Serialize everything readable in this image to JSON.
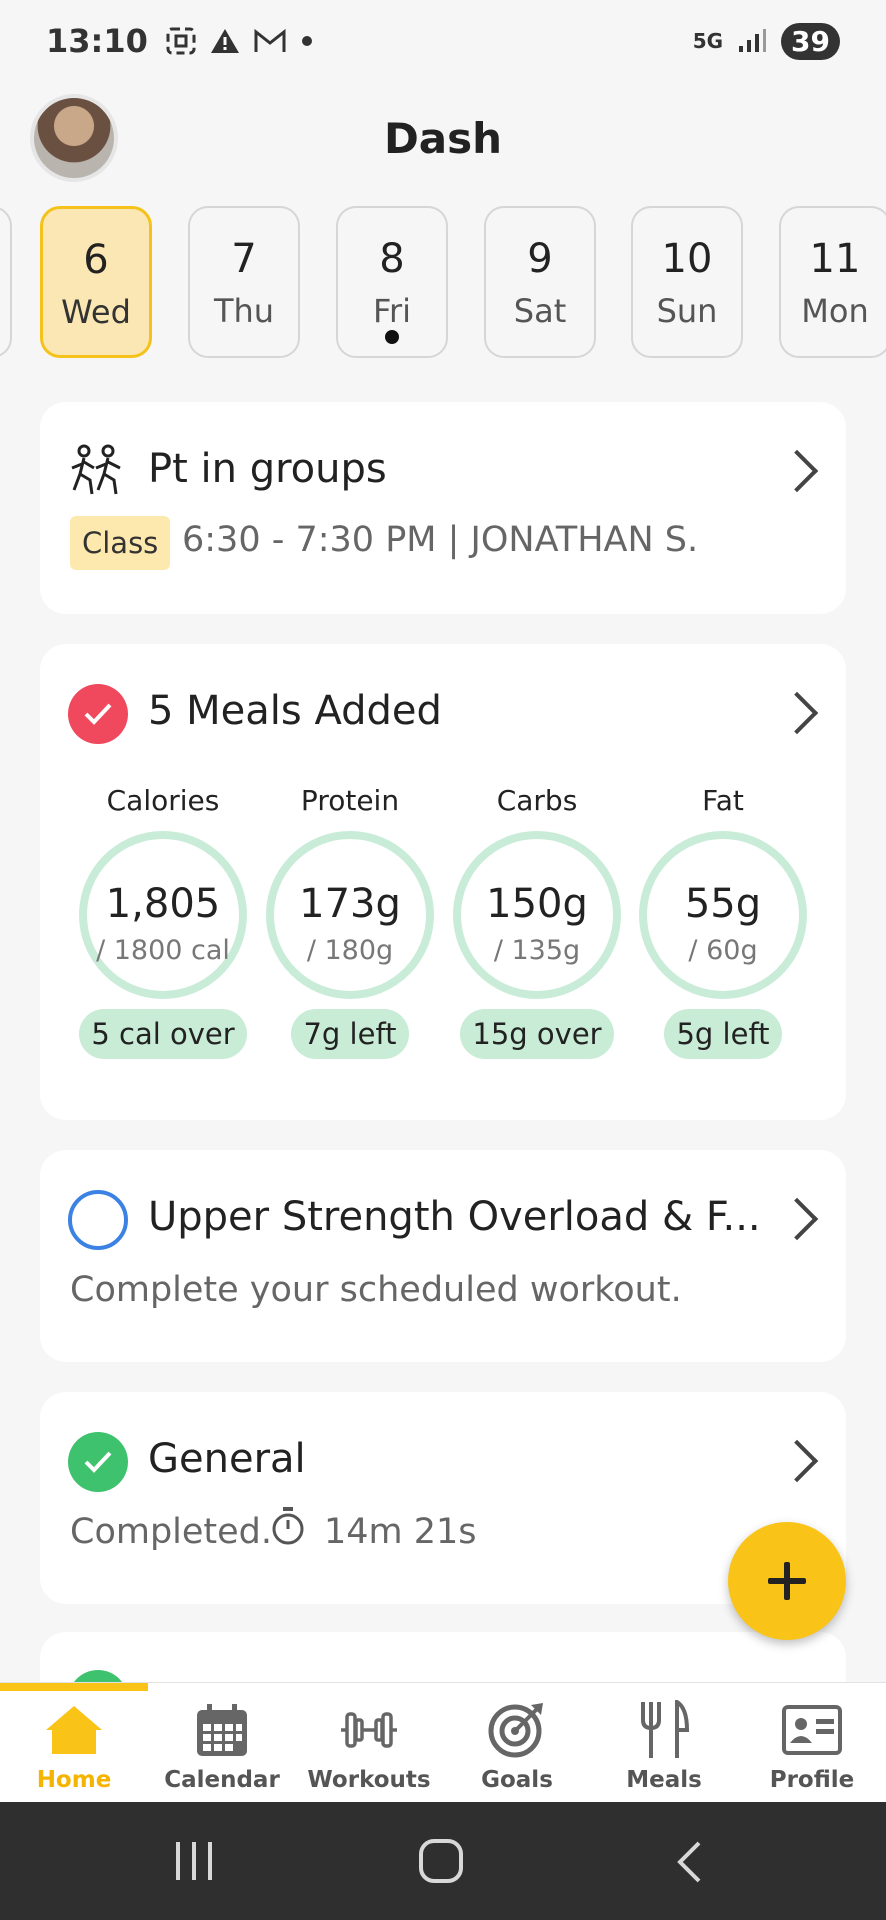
{
  "status_bar": {
    "time": "13:10",
    "network": "5G",
    "battery": "39"
  },
  "header": {
    "title": "Dash"
  },
  "dates": [
    {
      "num": "6",
      "day": "Wed",
      "selected": true
    },
    {
      "num": "7",
      "day": "Thu"
    },
    {
      "num": "8",
      "day": "Fri",
      "has_event": true
    },
    {
      "num": "9",
      "day": "Sat"
    },
    {
      "num": "10",
      "day": "Sun"
    },
    {
      "num": "11",
      "day": "Mon"
    }
  ],
  "class_card": {
    "title": "Pt in groups",
    "tag": "Class",
    "info": "6:30 - 7:30 PM | JONATHAN S."
  },
  "meals_card": {
    "title": "5 Meals Added",
    "macros": [
      {
        "label": "Calories",
        "value": "1,805",
        "target": "/ 1800 cal",
        "status": "5 cal over"
      },
      {
        "label": "Protein",
        "value": "173g",
        "target": "/ 180g",
        "status": "7g left"
      },
      {
        "label": "Carbs",
        "value": "150g",
        "target": "/ 135g",
        "status": "15g over"
      },
      {
        "label": "Fat",
        "value": "55g",
        "target": "/ 60g",
        "status": "5g left"
      }
    ]
  },
  "workout_card": {
    "title": "Upper Strength Overload & F...",
    "subtitle": "Complete your scheduled workout."
  },
  "general_card": {
    "title": "General",
    "completed": "Completed.",
    "duration": "14m 21s"
  },
  "nav": {
    "items": [
      {
        "label": "Home",
        "icon": "home-icon"
      },
      {
        "label": "Calendar",
        "icon": "calendar-icon"
      },
      {
        "label": "Workouts",
        "icon": "dumbbell-icon"
      },
      {
        "label": "Goals",
        "icon": "target-icon"
      },
      {
        "label": "Meals",
        "icon": "fork-knife-icon"
      },
      {
        "label": "Profile",
        "icon": "id-card-icon"
      }
    ]
  },
  "colors": {
    "accent": "#f9c318",
    "ring": "#c9ecd8",
    "red_check": "#f0485c",
    "green_check": "#3ec26d",
    "blue_ring": "#3b82e4"
  }
}
